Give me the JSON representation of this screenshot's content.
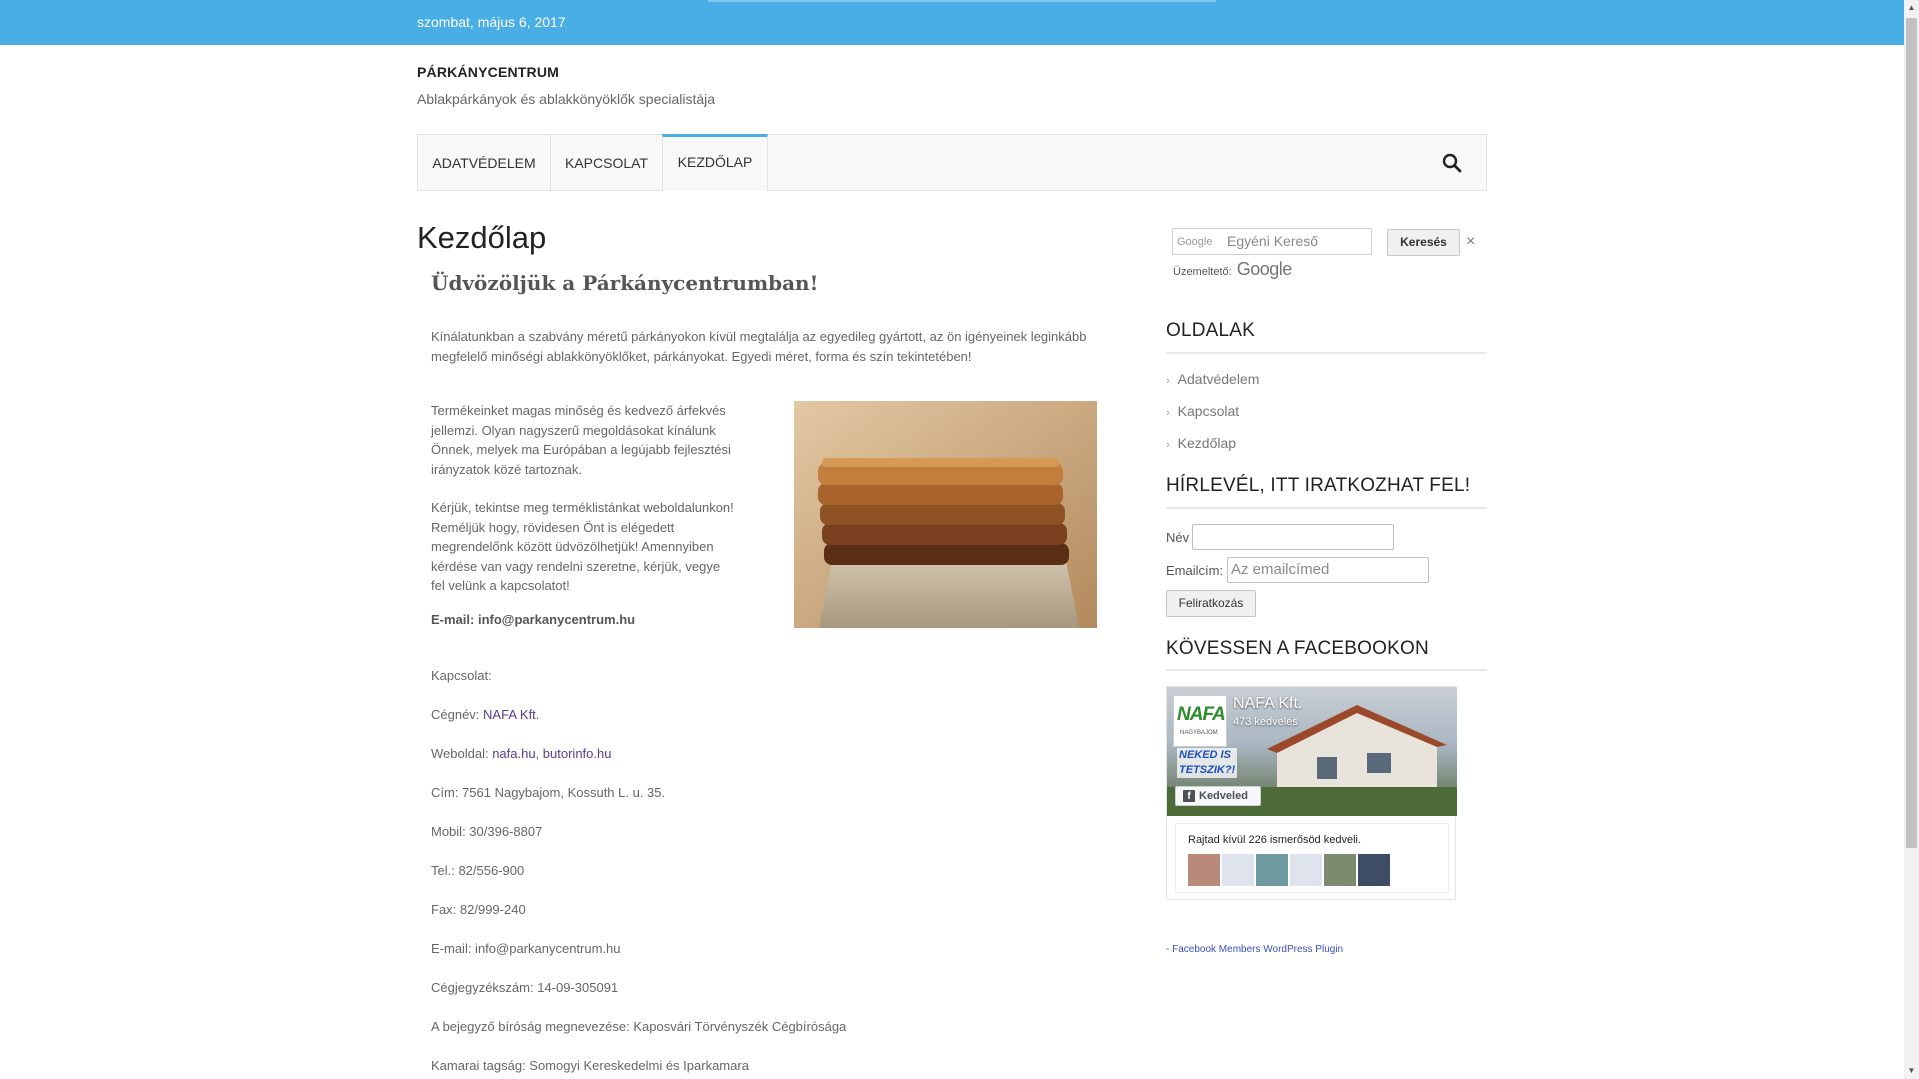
{
  "topbar": {
    "date": "szombat, május 6, 2017"
  },
  "site": {
    "title": "PÁRKÁNYCENTRUM",
    "description": "Ablakpárkányok és ablakkönyöklők specialistája"
  },
  "nav": {
    "items": [
      "ADATVÉDELEM",
      "KAPCSOLAT",
      "KEZDŐLAP"
    ],
    "active": "KEZDŐLAP"
  },
  "main": {
    "page_title": "Kezdőlap",
    "welcome": "Üdvözöljük a Párkánycentrumban!",
    "intro": "Kínálatunkban a szabvány méretű párkányokon kívül megtalálja az egyedileg gyártott, az ön igényeinek leginkább megfelelő minőségi ablakkönyöklőket, párkányokat. Egyedi méret, forma és szín tekintetében!",
    "para1": "Termékeinket magas minőség és kedvező árfekvés jellemzi. Olyan nagyszerű megoldásokat kínálunk Önnek, melyek ma Európában a legújabb fejlesztési irányzatok közé tartoznak.",
    "para2": "Kérjük, tekintse meg terméklistánkat weboldalunkon! Reméljük hogy, rövidesen Önt is elégedett megrendelőnk között üdvözölhetjük! Amennyiben kérdése van vagy rendelni szeretne, kérjük, vegye fel velünk a kapcsolatot!",
    "email_strong": "E-mail: info@parkanycentrum.hu",
    "contact": {
      "heading": "Kapcsolat:",
      "company_label": "Cégnév: ",
      "company_link": "NAFA Kft.",
      "website_label": "Weboldal: ",
      "website_link1": "nafa.hu",
      "website_sep": ", ",
      "website_link2": "butorinfo.hu",
      "address": "Cím: 7561 Nagybajom, Kossuth L. u. 35.",
      "mobile": "Mobil: 30/396-8807",
      "tel": "Tel.: 82/556-900",
      "fax": "Fax: 82/999-240",
      "email": "E-mail: info@parkanycentrum.hu",
      "reg": "Cégjegyzékszám: 14-09-305091",
      "court": "A bejegyző bíróság megnevezése: Kaposvári Törvényszék Cégbírósága",
      "chamber": "Kamarai tagság: Somogyi Kereskedelmi és Iparkamara"
    }
  },
  "sidebar": {
    "search": {
      "google_label": "Google",
      "placeholder": "Egyéni Kereső",
      "button": "Keresés",
      "close": "×",
      "powered": "Üzemeltető:",
      "logo": "Google"
    },
    "pages": {
      "title": "OLDALAK",
      "items": [
        "Adatvédelem",
        "Kapcsolat",
        "Kezdőlap"
      ]
    },
    "newsletter": {
      "title": "HÍRLEVÉL, ITT IRATKOZHAT FEL!",
      "name_label": "Név",
      "email_label": "Emailcím:",
      "email_placeholder": "Az emailcímed",
      "button": "Feliratkozás"
    },
    "facebook": {
      "title": "KÖVESSEN A FACEBOOKON",
      "page_name": "NAFA Kft.",
      "likes": "473 kedvelés",
      "logo_text": "NAFA",
      "logo_sub": "NAGYBAJOM",
      "promo_line1": "NEKED IS",
      "promo_line2": "TETSZIK?!",
      "like_button": "Kedveled",
      "friends_text": "Rajtad kívül 226 ismerősöd kedveli.",
      "plugin_link": "- Facebook Members WordPress Plugin"
    }
  }
}
